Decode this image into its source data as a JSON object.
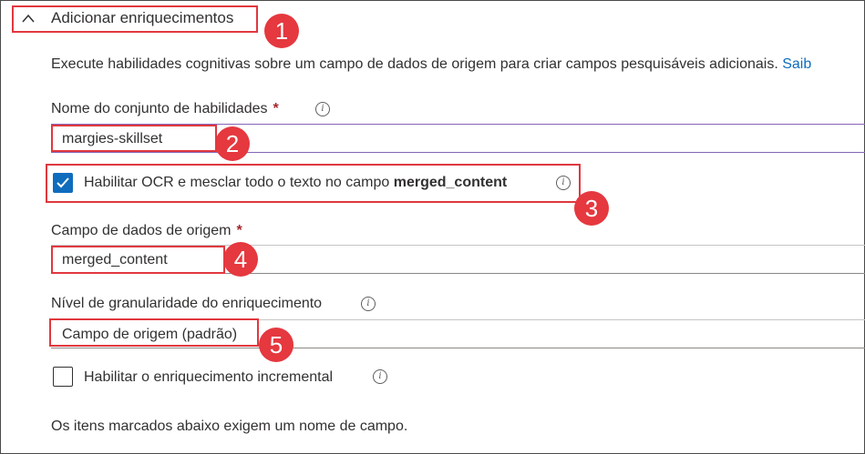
{
  "section": {
    "title": "Adicionar enriquecimentos",
    "description": "Execute habilidades cognitivas sobre um campo de dados de origem para criar campos pesquisáveis adicionais.",
    "learn_more": "Saib"
  },
  "skillset": {
    "label": "Nome do conjunto de habilidades",
    "required_mark": "*",
    "value": "margies-skillset"
  },
  "ocr": {
    "label_prefix": "Habilitar OCR e mesclar todo o texto no campo",
    "label_field": "merged_content",
    "checked": true
  },
  "source_field": {
    "label": "Campo de dados de origem",
    "required_mark": "*",
    "value": "merged_content"
  },
  "granularity": {
    "label": "Nível de granularidade do enriquecimento",
    "value": "Campo de origem (padrão)"
  },
  "incremental": {
    "label": "Habilitar o enriquecimento incremental",
    "checked": false
  },
  "footer_text": "Os itens marcados abaixo exigem um nome de campo.",
  "info_glyph": "i",
  "badges": [
    "1",
    "2",
    "3",
    "4",
    "5"
  ],
  "colors": {
    "accent": "#0f6cbd",
    "highlight": "#e0383e",
    "badge": "#e5383f",
    "required": "#a4262c"
  }
}
